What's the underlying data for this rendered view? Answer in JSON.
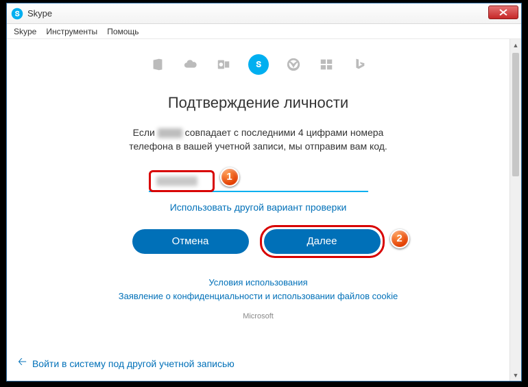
{
  "window": {
    "title": "Skype"
  },
  "menu": {
    "skype": "Skype",
    "tools": "Инструменты",
    "help": "Помощь"
  },
  "svc_icons": [
    "office",
    "onedrive",
    "outlook",
    "skype",
    "xbox",
    "windows",
    "bing"
  ],
  "heading": "Подтверждение личности",
  "description": {
    "pre": "Если ",
    "post": " совпадает с последними 4 цифрами номера телефона в вашей учетной записи, мы отправим вам код."
  },
  "alt_link": "Использовать другой вариант проверки",
  "buttons": {
    "cancel": "Отмена",
    "next": "Далее"
  },
  "legal": {
    "terms": "Условия использования",
    "privacy": "Заявление о конфиденциальности и использовании файлов cookie",
    "brand": "Microsoft"
  },
  "footer": {
    "switch_account": "Войти в систему под другой учетной записью"
  },
  "annotations": {
    "badge1": "1",
    "badge2": "2"
  }
}
